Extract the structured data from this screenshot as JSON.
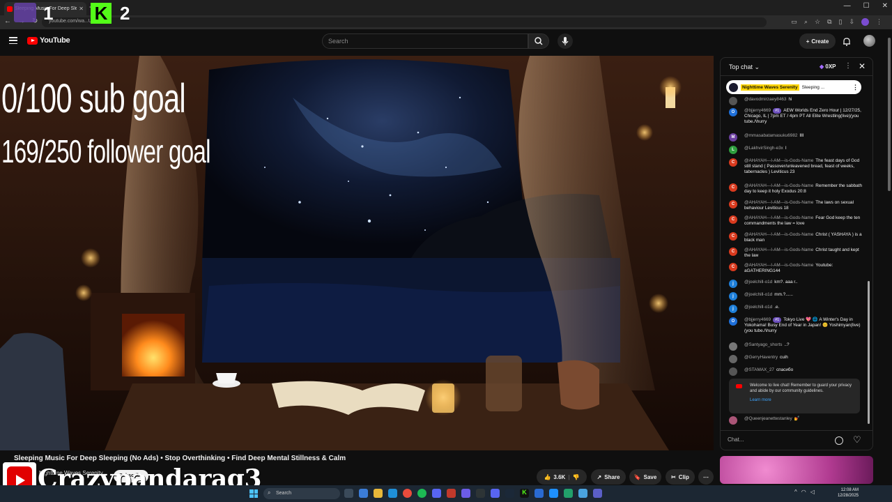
{
  "browser": {
    "tab_title": "Sleeping Music For Deep Sle...",
    "url": "youtube.com/wa...UC..."
  },
  "overlay": {
    "label_1": "1",
    "label_2": "2",
    "kick_letter": "K",
    "sub_goal": "0/100 sub goal",
    "follower_goal": "169/250 follower goal",
    "streamer_name": "Crazypandarag3"
  },
  "header": {
    "logo_text": "YouTube",
    "search_placeholder": "Search",
    "create_label": "Create"
  },
  "video": {
    "title": "Sleeping Music For Deep Sleeping (No Ads) • Stop Overthinking • Find Deep Mental Stillness & Calm",
    "channel": "Nighttime Waves Serenity",
    "subscribe_label": "Subscribe",
    "likes": "3.6K",
    "share_label": "Share",
    "save_label": "Save",
    "clip_label": "Clip"
  },
  "chat": {
    "title": "Top chat",
    "xp": "0XP",
    "pinned_name": "Nighttime Waves Serenity",
    "pinned_text": "Sleeping ...",
    "messages": [
      {
        "author": "@davodmirzaey8463",
        "text": "hi",
        "initial": "",
        "color": "#555"
      },
      {
        "author": "@bjjerry4669",
        "badge": "#1",
        "text": "AEW Worlds End Zero Hour | 12/27/25, Chicago, IL | 7pm ET / 4pm PT All Elite Wrestling(live)(you tube./\\hurry",
        "initial": "O",
        "color": "#1e6fd9"
      },
      {
        "author": "@mmasabatamasuku6982",
        "text": "llll",
        "initial": "M",
        "color": "#6b3fa0"
      },
      {
        "author": "@LakhvirSingh-e3x",
        "text": "I",
        "initial": "L",
        "color": "#2e9e3e"
      },
      {
        "author": "@AHAYAH---I-AM---is-Gods-Name",
        "text": "The feast days of God still stand ( Passover/unleavened bread, feast of weeks, tabernacles ) Leviticus 23",
        "initial": "C",
        "color": "#d93a1e"
      },
      {
        "author": "@AHAYAH---I-AM---is-Gods-Name",
        "text": "Remember the sabbath day to keep it holy Exodus 20:8",
        "initial": "C",
        "color": "#d93a1e"
      },
      {
        "author": "@AHAYAH---I-AM---is-Gods-Name",
        "text": "The laws on sexual behaviour Leviticus 18",
        "initial": "C",
        "color": "#d93a1e"
      },
      {
        "author": "@AHAYAH---I-AM---is-Gods-Name",
        "text": "Fear God keep the ten commandments the law = love",
        "initial": "C",
        "color": "#d93a1e"
      },
      {
        "author": "@AHAYAH---I-AM---is-Gods-Name",
        "text": "Christ ( YASHAYA ) is a black man",
        "initial": "C",
        "color": "#d93a1e"
      },
      {
        "author": "@AHAYAH---I-AM---is-Gods-Name",
        "text": "Christ taught and kept the law",
        "initial": "C",
        "color": "#d93a1e"
      },
      {
        "author": "@AHAYAH---I-AM---is-Gods-Name",
        "text": "Youtube: aGATHERING144",
        "initial": "C",
        "color": "#d93a1e"
      },
      {
        "author": "@joelchill-o1d",
        "text": "km?. aaa r..",
        "initial": "j",
        "color": "#1e7fd9"
      },
      {
        "author": "@joelchill-o1d",
        "text": "mm.?......",
        "initial": "j",
        "color": "#1e7fd9"
      },
      {
        "author": "@joelchill-o1d",
        "text": ".e.",
        "initial": "j",
        "color": "#1e7fd9"
      },
      {
        "author": "@bjjerry4669",
        "badge": "#1",
        "text": "Tokyo Live 💖 🌐 A Winter's Day in Yokohama! Busy End of Year in Japan! 😊 Yoshimyan(live)(you tube./\\hurry",
        "initial": "O",
        "color": "#1e6fd9"
      },
      {
        "author": "@Santyago_shorts",
        "text": "..?",
        "initial": "",
        "color": "#777"
      },
      {
        "author": "@GerryHaventry",
        "text": "cuih",
        "initial": "",
        "color": "#666"
      },
      {
        "author": "@STAMAX_27",
        "text": "спасибо",
        "initial": "",
        "color": "#555"
      }
    ],
    "welcome_text": "Welcome to live chat! Remember to guard your privacy and abide by our community guidelines.",
    "learn_more": "Learn more",
    "last_author": "@Queenjeanettestanley",
    "last_text": "💅",
    "input_placeholder": "Chat..."
  },
  "taskbar": {
    "search_placeholder": "Search",
    "time": "12:08 AM",
    "date": "12/28/2025"
  }
}
